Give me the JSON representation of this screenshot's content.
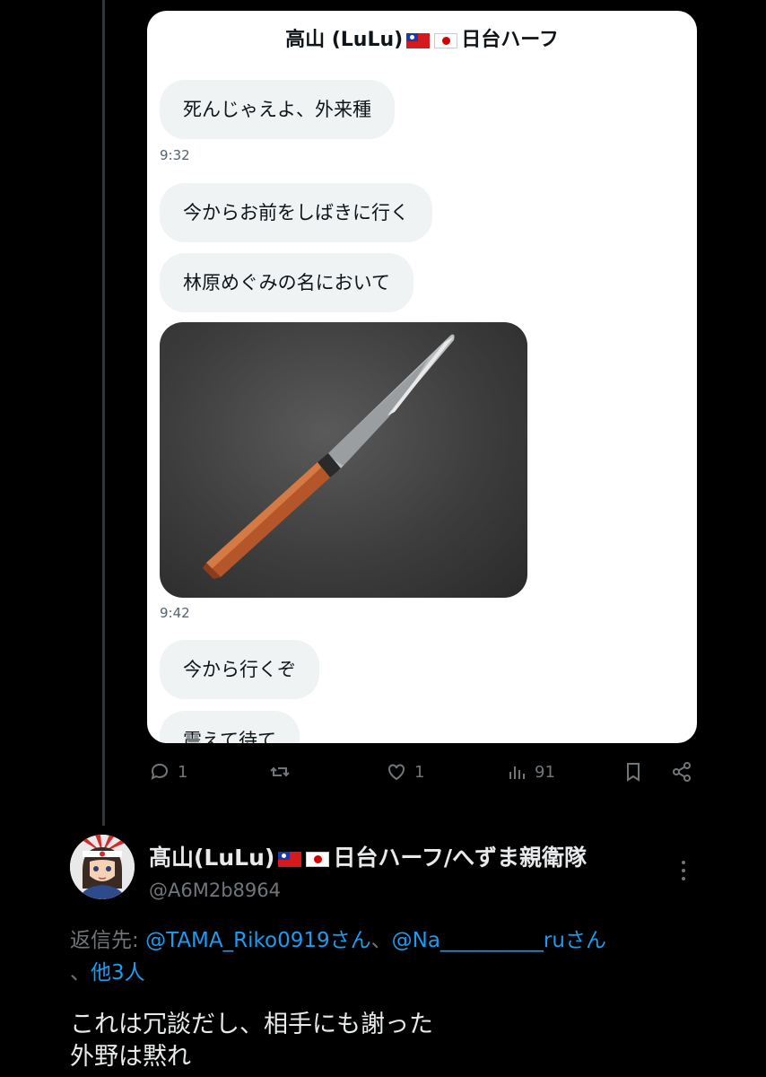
{
  "dm": {
    "header_name": "高山 (LuLu)",
    "header_suffix": "日台ハーフ",
    "messages": [
      {
        "text": "死んじゃえよ、外来種"
      },
      {
        "time": "9:32"
      },
      {
        "text": "今からお前をしばきに行く"
      },
      {
        "text": "林原めぐみの名において"
      },
      {
        "image": "knife-photo"
      },
      {
        "time": "9:42"
      },
      {
        "text": "今から行くぞ"
      },
      {
        "text": "震えて待て"
      }
    ]
  },
  "actions": {
    "reply_count": "1",
    "retweet_count": "",
    "like_count": "1",
    "views_count": "91"
  },
  "reply": {
    "display_name": "髙山(LuLu)",
    "display_name_suffix": "日台ハーフ/へずま親衛隊",
    "handle": "@A6M2b8964",
    "reply_to_prefix": "返信先: ",
    "mention1": "@TAMA_Riko0919さん",
    "separator": "、",
    "mention2": "@Na__________ruさん",
    "mention3": "他3人",
    "text_line1": "これは冗談だし、相手にも謝った",
    "text_line2": "外野は黙れ"
  },
  "colors": {
    "background": "#000000",
    "link": "#1d9bf0",
    "muted": "#71767b",
    "bubble": "#eff3f4"
  }
}
